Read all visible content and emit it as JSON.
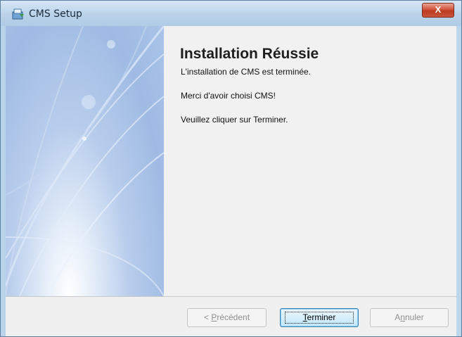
{
  "window": {
    "title": "CMS Setup",
    "close_label": "X"
  },
  "content": {
    "title": "Installation Réussie",
    "line1": "L'installation de CMS  est terminée.",
    "line2": "Merci d'avoir choisi CMS!",
    "line3": "Veuillez cliquer sur Terminer."
  },
  "buttons": {
    "previous": {
      "prefix": "< ",
      "accel": "P",
      "rest": "récédent"
    },
    "finish": {
      "accel": "T",
      "rest": "erminer"
    },
    "cancel": {
      "pre": "A",
      "accel": "n",
      "rest": "nuler"
    }
  },
  "icons": {
    "app": "installer-icon",
    "close": "close-icon"
  },
  "colors": {
    "titlebar": "#bcd4ea",
    "close_button": "#c9553e",
    "default_button_border": "#3c7fb1"
  }
}
